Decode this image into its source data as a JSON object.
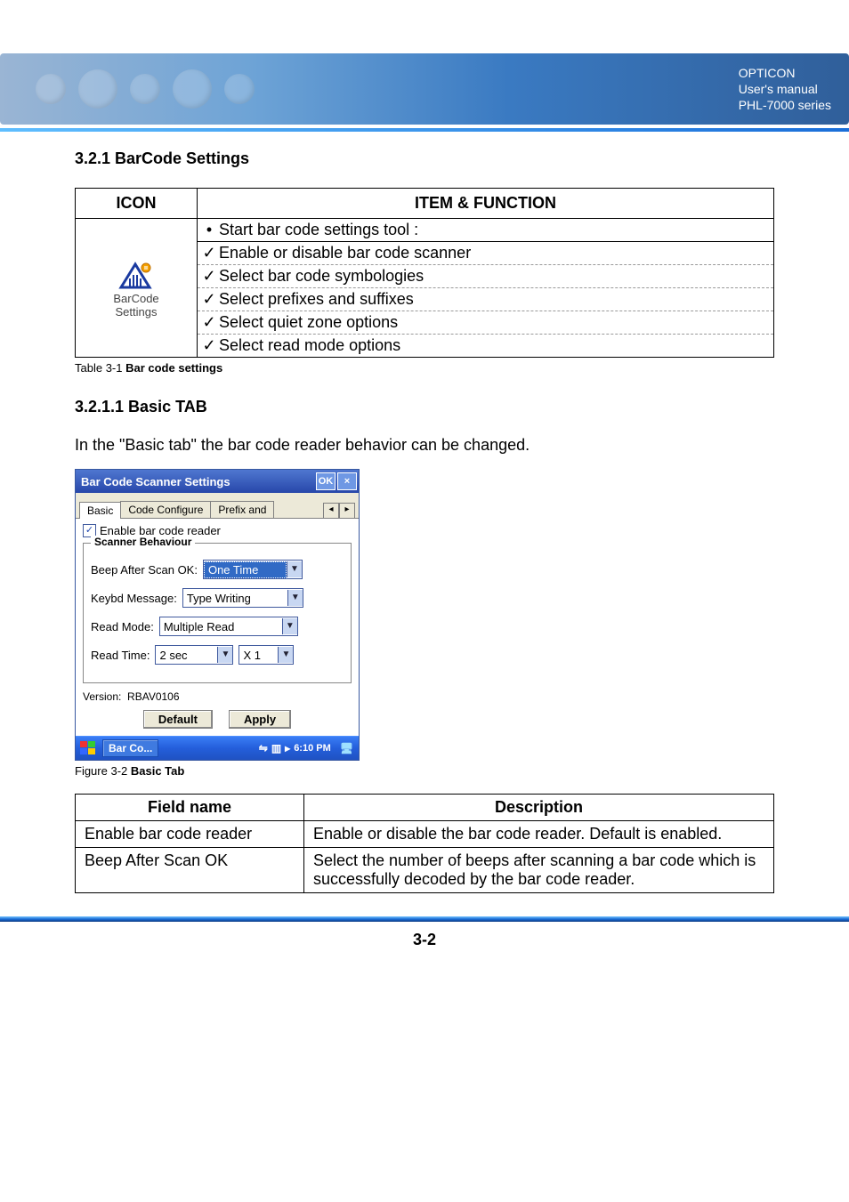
{
  "header": {
    "line1": "OPTICON",
    "line2": "User's manual",
    "line3": "PHL-7000 series"
  },
  "section": {
    "title": "3.2.1 BarCode Settings"
  },
  "icon_table": {
    "headers": {
      "icon": "ICON",
      "item": "ITEM & FUNCTION"
    },
    "icon_label1": "BarCode",
    "icon_label2": "Settings",
    "intro": "Start bar code settings tool :",
    "items": [
      "Enable or disable bar code scanner",
      "Select bar code symbologies",
      "Select prefixes and suffixes",
      "Select quiet zone options",
      "Select read mode options"
    ]
  },
  "table_caption": {
    "prefix": "Table 3-1 ",
    "bold": "Bar code settings"
  },
  "subsection": {
    "title": "3.2.1.1 Basic TAB",
    "intro": "In the \"Basic tab\" the bar code reader behavior can be changed."
  },
  "screenshot": {
    "title": "Bar Code Scanner Settings",
    "ok": "OK",
    "close": "×",
    "tabs": {
      "t1": "Basic",
      "t2": "Code Configure",
      "t3": "Prefix and"
    },
    "enable_label": "Enable bar code reader",
    "group_label": "Scanner Behaviour",
    "beep_label": "Beep After Scan OK:",
    "beep_value": "One Time",
    "keybd_label": "Keybd Message:",
    "keybd_value": "Type Writing",
    "readmode_label": "Read Mode:",
    "readmode_value": "Multiple Read",
    "readtime_label": "Read Time:",
    "readtime_val1": "2 sec",
    "readtime_val2": "X 1",
    "version_label": "Version:",
    "version_value": "RBAV0106",
    "btn_default": "Default",
    "btn_apply": "Apply",
    "task_label": "Bar Co...",
    "tray_time": "6:10 PM"
  },
  "figure_caption": {
    "prefix": "Figure 3-2 ",
    "bold": "Basic Tab"
  },
  "desc_table": {
    "headers": {
      "field": "Field name",
      "desc": "Description"
    },
    "rows": [
      {
        "field": "Enable bar code reader",
        "desc": "Enable or disable the bar code reader. Default is enabled."
      },
      {
        "field": "Beep After Scan OK",
        "desc": "Select the number of beeps after scanning a bar code which is successfully decoded by the bar code reader."
      }
    ]
  },
  "page_number": "3-2"
}
